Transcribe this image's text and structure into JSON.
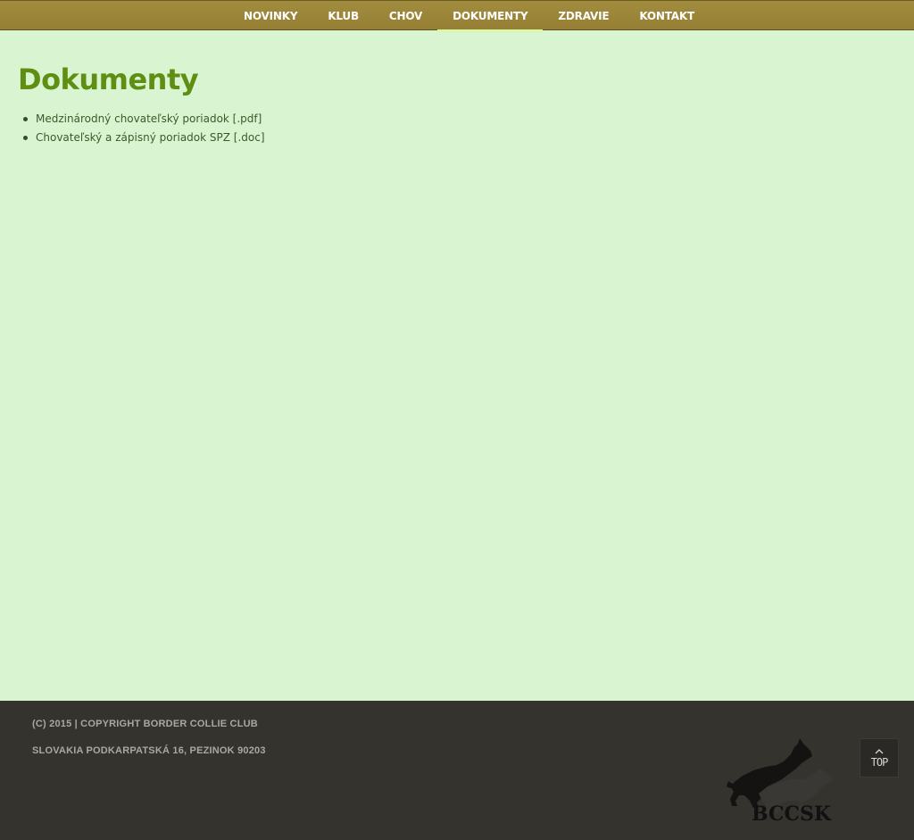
{
  "nav": {
    "items": [
      {
        "label": "NOVINKY",
        "active": false
      },
      {
        "label": "KLUB",
        "active": false
      },
      {
        "label": "CHOV",
        "active": false
      },
      {
        "label": "DOKUMENTY",
        "active": true
      },
      {
        "label": "ZDRAVIE",
        "active": false
      },
      {
        "label": "KONTAKT",
        "active": false
      }
    ]
  },
  "main": {
    "title": "Dokumenty",
    "documents": [
      {
        "label": "Medzinárodný chovateľský poriadok [.pdf]"
      },
      {
        "label": "Chovateľský a zápisný poriadok SPZ [.doc]"
      }
    ]
  },
  "footer": {
    "copyright": "(C) 2015  |  COPYRIGHT BORDER COLLIE CLUB",
    "address": "SLOVAKIA PODKARPATSKÁ 16, PEZINOK 90203",
    "logo_text": "BCCSK",
    "top_label": "TOP"
  },
  "colors": {
    "nav_bg": "#9b8639",
    "page_bg": "#d9f4d1",
    "title": "#5e8f12",
    "active_underline": "#d9f7a9",
    "footer_bg": "#35332e"
  },
  "icons": {
    "logo": "border-collie-dogs-logo",
    "top": "chevron-up-icon"
  }
}
